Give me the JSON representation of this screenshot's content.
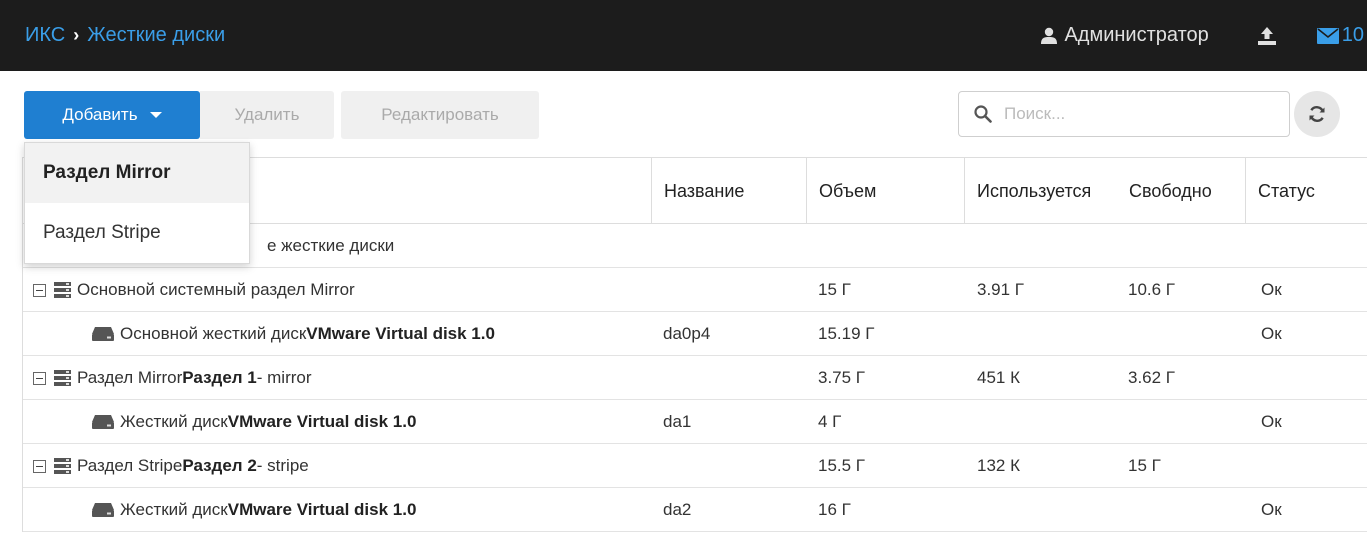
{
  "breadcrumb": {
    "root": "ИКС",
    "current": "Жесткие диски"
  },
  "header": {
    "user": "Администратор",
    "messages_count": "10"
  },
  "toolbar": {
    "add_label": "Добавить",
    "delete_label": "Удалить",
    "edit_label": "Редактировать",
    "search_placeholder": "Поиск..."
  },
  "dropdown": {
    "items": [
      {
        "label": "Раздел Mirror"
      },
      {
        "label": "Раздел Stripe"
      }
    ]
  },
  "columns": {
    "name": "Название",
    "size": "Объем",
    "used": "Используется",
    "free": "Свободно",
    "status": "Статус"
  },
  "rows": [
    {
      "pre": "",
      "bold": "",
      "post": "е жесткие диски",
      "name": "",
      "size": "",
      "used": "",
      "free": "",
      "status": ""
    },
    {
      "pre": "Основной системный раздел Mirror",
      "bold": "",
      "post": "",
      "name": "",
      "size": "15 Г",
      "used": "3.91 Г",
      "free": "10.6 Г",
      "status": "Ок"
    },
    {
      "pre": "Основной жесткий диск ",
      "bold": "VMware Virtual disk 1.0",
      "post": "",
      "name": "da0p4",
      "size": "15.19 Г",
      "used": "",
      "free": "",
      "status": "Ок"
    },
    {
      "pre": "Раздел Mirror ",
      "bold": "Раздел 1",
      "post": " - mirror",
      "name": "",
      "size": "3.75 Г",
      "used": "451 К",
      "free": "3.62 Г",
      "status": ""
    },
    {
      "pre": "Жесткий диск ",
      "bold": "VMware Virtual disk 1.0",
      "post": "",
      "name": "da1",
      "size": "4 Г",
      "used": "",
      "free": "",
      "status": "Ок"
    },
    {
      "pre": "Раздел Stripe ",
      "bold": "Раздел 2",
      "post": " - stripe",
      "name": "",
      "size": "15.5 Г",
      "used": "132 К",
      "free": "15 Г",
      "status": ""
    },
    {
      "pre": "Жесткий диск ",
      "bold": "VMware Virtual disk 1.0",
      "post": "",
      "name": "da2",
      "size": "16 Г",
      "used": "",
      "free": "",
      "status": "Ок"
    }
  ]
}
